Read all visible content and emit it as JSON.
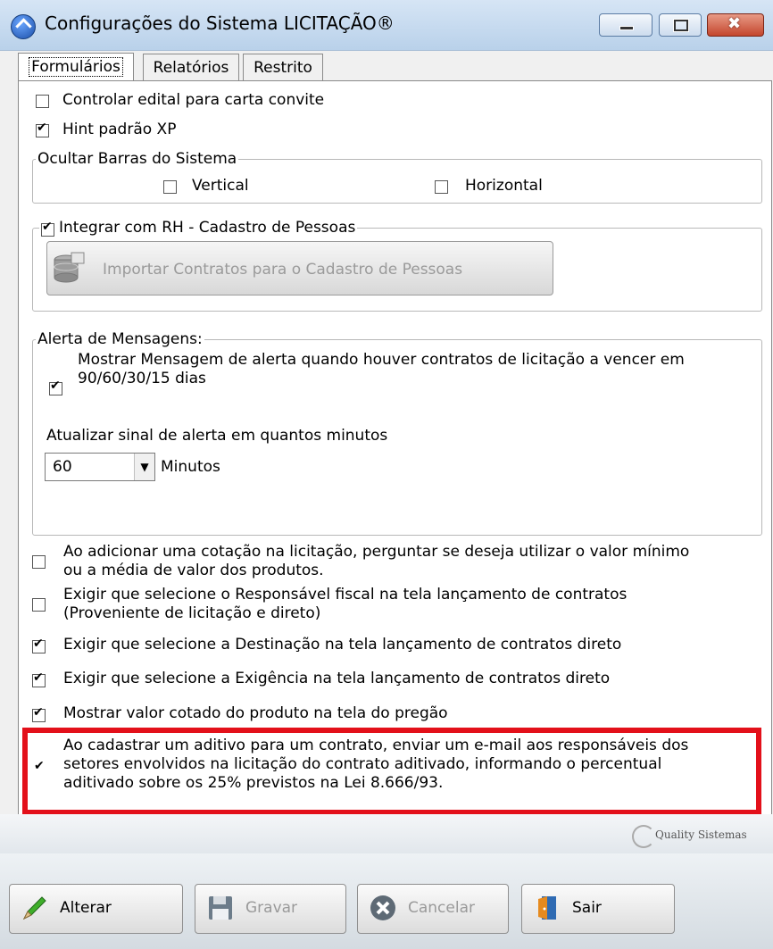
{
  "window": {
    "title": "Configurações do Sistema LICITAÇÃO®"
  },
  "tabs": [
    {
      "label": "Formulários",
      "active": true
    },
    {
      "label": "Relatórios",
      "active": false
    },
    {
      "label": "Restrito",
      "active": false
    }
  ],
  "options_top": [
    {
      "label": "Controlar edital para carta convite",
      "checked": false
    },
    {
      "label": "Hint padrão XP",
      "checked": true
    }
  ],
  "ocultar_barras": {
    "legend": "Ocultar Barras do Sistema",
    "vertical": {
      "label": "Vertical",
      "checked": false
    },
    "horizontal": {
      "label": "Horizontal",
      "checked": false
    }
  },
  "integrar_rh": {
    "label": "Integrar com RH - Cadastro de Pessoas",
    "checked": true,
    "import_button": "Importar Contratos para o Cadastro de Pessoas"
  },
  "alerta": {
    "legend": "Alerta de Mensagens:",
    "checkbox_line1": "Mostrar Mensagem de alerta quando houver contratos de licitação a vencer em",
    "checkbox_line2": "90/60/30/15 dias",
    "checked": true,
    "interval_label": "Atualizar sinal de alerta em  quantos minutos",
    "interval_value": "60",
    "interval_unit": "Minutos"
  },
  "options_bottom": [
    {
      "line1": "Ao adicionar uma cotação na licitação, perguntar se deseja utilizar o valor mínimo",
      "line2": "ou a média de valor dos produtos.",
      "checked": false
    },
    {
      "line1": "Exigir que selecione o Responsável fiscal na tela lançamento de contratos",
      "line2": "(Proveniente de licitação e direto)",
      "checked": false
    },
    {
      "line1": "Exigir que selecione a Destinação na tela lançamento de contratos direto",
      "checked": true
    },
    {
      "line1": "Exigir que selecione a Exigência na tela lançamento de contratos direto",
      "checked": true
    },
    {
      "line1": "Mostrar valor cotado do produto na tela do pregão",
      "checked": true
    },
    {
      "line1": "Ao cadastrar um aditivo para um contrato, enviar um e-mail aos responsáveis dos",
      "line2": "setores envolvidos na licitação do contrato aditivado, informando o percentual",
      "line3": "aditivado sobre os 25% previstos na Lei 8.666/93.",
      "checked": true
    }
  ],
  "logo": {
    "text": "Quality Sistemas"
  },
  "footer_buttons": [
    {
      "label": "Alterar",
      "enabled": true,
      "icon": "pencil-icon"
    },
    {
      "label": "Gravar",
      "enabled": false,
      "icon": "floppy-icon"
    },
    {
      "label": "Cancelar",
      "enabled": false,
      "icon": "cancel-icon"
    },
    {
      "label": "Sair",
      "enabled": true,
      "icon": "exit-door-icon"
    }
  ],
  "colors": {
    "highlight": "#e3101a",
    "title_bar": "#c6dbf1"
  }
}
